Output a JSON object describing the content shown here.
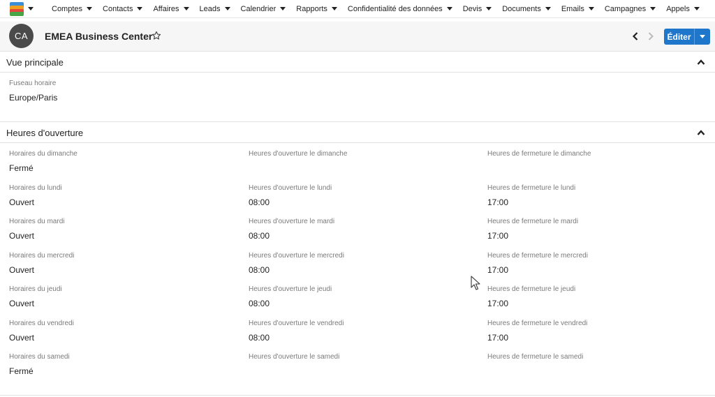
{
  "nav": {
    "items": [
      {
        "label": "Comptes"
      },
      {
        "label": "Contacts"
      },
      {
        "label": "Affaires"
      },
      {
        "label": "Leads"
      },
      {
        "label": "Calendrier"
      },
      {
        "label": "Rapports"
      },
      {
        "label": "Confidentialité des données"
      },
      {
        "label": "Devis"
      },
      {
        "label": "Documents"
      },
      {
        "label": "Emails"
      },
      {
        "label": "Campagnes"
      },
      {
        "label": "Appels"
      }
    ]
  },
  "record": {
    "avatar_initials": "CA",
    "title": "EMEA Business Center",
    "edit_label": "Éditer"
  },
  "panels": {
    "main": {
      "title": "Vue principale",
      "timezone_label": "Fuseau horaire",
      "timezone_value": "Europe/Paris"
    },
    "hours": {
      "title": "Heures d'ouverture",
      "rows": [
        {
          "status_label": "Horaires du dimanche",
          "status": "Fermé",
          "open_label": "Heures d'ouverture le dimanche",
          "open": "",
          "close_label": "Heures de fermeture le dimanche",
          "close": ""
        },
        {
          "status_label": "Horaires du lundi",
          "status": "Ouvert",
          "open_label": "Heures d'ouverture le lundi",
          "open": "08:00",
          "close_label": "Heures de fermeture le lundi",
          "close": "17:00"
        },
        {
          "status_label": "Horaires du mardi",
          "status": "Ouvert",
          "open_label": "Heures d'ouverture le mardi",
          "open": "08:00",
          "close_label": "Heures de fermeture le mardi",
          "close": "17:00"
        },
        {
          "status_label": "Horaires du mercredi",
          "status": "Ouvert",
          "open_label": "Heures d'ouverture le mercredi",
          "open": "08:00",
          "close_label": "Heures de fermeture le mercredi",
          "close": "17:00"
        },
        {
          "status_label": "Horaires du jeudi",
          "status": "Ouvert",
          "open_label": "Heures d'ouverture le jeudi",
          "open": "08:00",
          "close_label": "Heures de fermeture le jeudi",
          "close": "17:00"
        },
        {
          "status_label": "Horaires du vendredi",
          "status": "Ouvert",
          "open_label": "Heures d'ouverture le vendredi",
          "open": "08:00",
          "close_label": "Heures de fermeture le vendredi",
          "close": "17:00"
        },
        {
          "status_label": "Horaires du samedi",
          "status": "Fermé",
          "open_label": "Heures d'ouverture le samedi",
          "open": "",
          "close_label": "Heures de fermeture le samedi",
          "close": ""
        }
      ]
    }
  },
  "icons": {
    "logo": "app-logo-icon",
    "star": "star-outline-icon",
    "prev": "chevron-left-icon",
    "next": "chevron-right-icon",
    "collapse": "chevron-up-icon"
  },
  "colors": {
    "primary": "#1f77cc",
    "avatar_bg": "#4a4a4a"
  }
}
